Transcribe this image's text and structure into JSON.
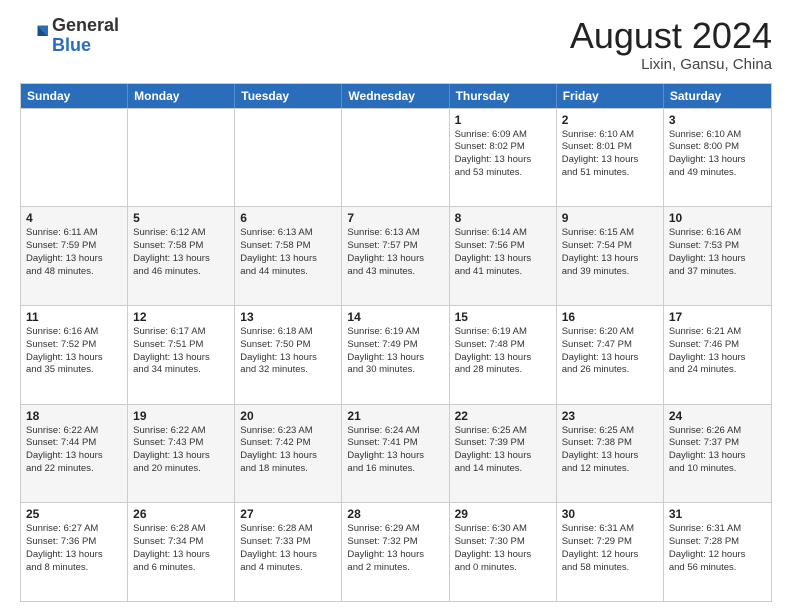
{
  "header": {
    "logo_general": "General",
    "logo_blue": "Blue",
    "month_title": "August 2024",
    "location": "Lixin, Gansu, China"
  },
  "days_of_week": [
    "Sunday",
    "Monday",
    "Tuesday",
    "Wednesday",
    "Thursday",
    "Friday",
    "Saturday"
  ],
  "weeks": [
    {
      "shaded": false,
      "cells": [
        {
          "empty": true,
          "day": "",
          "text": ""
        },
        {
          "empty": true,
          "day": "",
          "text": ""
        },
        {
          "empty": true,
          "day": "",
          "text": ""
        },
        {
          "empty": true,
          "day": "",
          "text": ""
        },
        {
          "empty": false,
          "day": "1",
          "text": "Sunrise: 6:09 AM\nSunset: 8:02 PM\nDaylight: 13 hours\nand 53 minutes."
        },
        {
          "empty": false,
          "day": "2",
          "text": "Sunrise: 6:10 AM\nSunset: 8:01 PM\nDaylight: 13 hours\nand 51 minutes."
        },
        {
          "empty": false,
          "day": "3",
          "text": "Sunrise: 6:10 AM\nSunset: 8:00 PM\nDaylight: 13 hours\nand 49 minutes."
        }
      ]
    },
    {
      "shaded": true,
      "cells": [
        {
          "empty": false,
          "day": "4",
          "text": "Sunrise: 6:11 AM\nSunset: 7:59 PM\nDaylight: 13 hours\nand 48 minutes."
        },
        {
          "empty": false,
          "day": "5",
          "text": "Sunrise: 6:12 AM\nSunset: 7:58 PM\nDaylight: 13 hours\nand 46 minutes."
        },
        {
          "empty": false,
          "day": "6",
          "text": "Sunrise: 6:13 AM\nSunset: 7:58 PM\nDaylight: 13 hours\nand 44 minutes."
        },
        {
          "empty": false,
          "day": "7",
          "text": "Sunrise: 6:13 AM\nSunset: 7:57 PM\nDaylight: 13 hours\nand 43 minutes."
        },
        {
          "empty": false,
          "day": "8",
          "text": "Sunrise: 6:14 AM\nSunset: 7:56 PM\nDaylight: 13 hours\nand 41 minutes."
        },
        {
          "empty": false,
          "day": "9",
          "text": "Sunrise: 6:15 AM\nSunset: 7:54 PM\nDaylight: 13 hours\nand 39 minutes."
        },
        {
          "empty": false,
          "day": "10",
          "text": "Sunrise: 6:16 AM\nSunset: 7:53 PM\nDaylight: 13 hours\nand 37 minutes."
        }
      ]
    },
    {
      "shaded": false,
      "cells": [
        {
          "empty": false,
          "day": "11",
          "text": "Sunrise: 6:16 AM\nSunset: 7:52 PM\nDaylight: 13 hours\nand 35 minutes."
        },
        {
          "empty": false,
          "day": "12",
          "text": "Sunrise: 6:17 AM\nSunset: 7:51 PM\nDaylight: 13 hours\nand 34 minutes."
        },
        {
          "empty": false,
          "day": "13",
          "text": "Sunrise: 6:18 AM\nSunset: 7:50 PM\nDaylight: 13 hours\nand 32 minutes."
        },
        {
          "empty": false,
          "day": "14",
          "text": "Sunrise: 6:19 AM\nSunset: 7:49 PM\nDaylight: 13 hours\nand 30 minutes."
        },
        {
          "empty": false,
          "day": "15",
          "text": "Sunrise: 6:19 AM\nSunset: 7:48 PM\nDaylight: 13 hours\nand 28 minutes."
        },
        {
          "empty": false,
          "day": "16",
          "text": "Sunrise: 6:20 AM\nSunset: 7:47 PM\nDaylight: 13 hours\nand 26 minutes."
        },
        {
          "empty": false,
          "day": "17",
          "text": "Sunrise: 6:21 AM\nSunset: 7:46 PM\nDaylight: 13 hours\nand 24 minutes."
        }
      ]
    },
    {
      "shaded": true,
      "cells": [
        {
          "empty": false,
          "day": "18",
          "text": "Sunrise: 6:22 AM\nSunset: 7:44 PM\nDaylight: 13 hours\nand 22 minutes."
        },
        {
          "empty": false,
          "day": "19",
          "text": "Sunrise: 6:22 AM\nSunset: 7:43 PM\nDaylight: 13 hours\nand 20 minutes."
        },
        {
          "empty": false,
          "day": "20",
          "text": "Sunrise: 6:23 AM\nSunset: 7:42 PM\nDaylight: 13 hours\nand 18 minutes."
        },
        {
          "empty": false,
          "day": "21",
          "text": "Sunrise: 6:24 AM\nSunset: 7:41 PM\nDaylight: 13 hours\nand 16 minutes."
        },
        {
          "empty": false,
          "day": "22",
          "text": "Sunrise: 6:25 AM\nSunset: 7:39 PM\nDaylight: 13 hours\nand 14 minutes."
        },
        {
          "empty": false,
          "day": "23",
          "text": "Sunrise: 6:25 AM\nSunset: 7:38 PM\nDaylight: 13 hours\nand 12 minutes."
        },
        {
          "empty": false,
          "day": "24",
          "text": "Sunrise: 6:26 AM\nSunset: 7:37 PM\nDaylight: 13 hours\nand 10 minutes."
        }
      ]
    },
    {
      "shaded": false,
      "cells": [
        {
          "empty": false,
          "day": "25",
          "text": "Sunrise: 6:27 AM\nSunset: 7:36 PM\nDaylight: 13 hours\nand 8 minutes."
        },
        {
          "empty": false,
          "day": "26",
          "text": "Sunrise: 6:28 AM\nSunset: 7:34 PM\nDaylight: 13 hours\nand 6 minutes."
        },
        {
          "empty": false,
          "day": "27",
          "text": "Sunrise: 6:28 AM\nSunset: 7:33 PM\nDaylight: 13 hours\nand 4 minutes."
        },
        {
          "empty": false,
          "day": "28",
          "text": "Sunrise: 6:29 AM\nSunset: 7:32 PM\nDaylight: 13 hours\nand 2 minutes."
        },
        {
          "empty": false,
          "day": "29",
          "text": "Sunrise: 6:30 AM\nSunset: 7:30 PM\nDaylight: 13 hours\nand 0 minutes."
        },
        {
          "empty": false,
          "day": "30",
          "text": "Sunrise: 6:31 AM\nSunset: 7:29 PM\nDaylight: 12 hours\nand 58 minutes."
        },
        {
          "empty": false,
          "day": "31",
          "text": "Sunrise: 6:31 AM\nSunset: 7:28 PM\nDaylight: 12 hours\nand 56 minutes."
        }
      ]
    }
  ]
}
